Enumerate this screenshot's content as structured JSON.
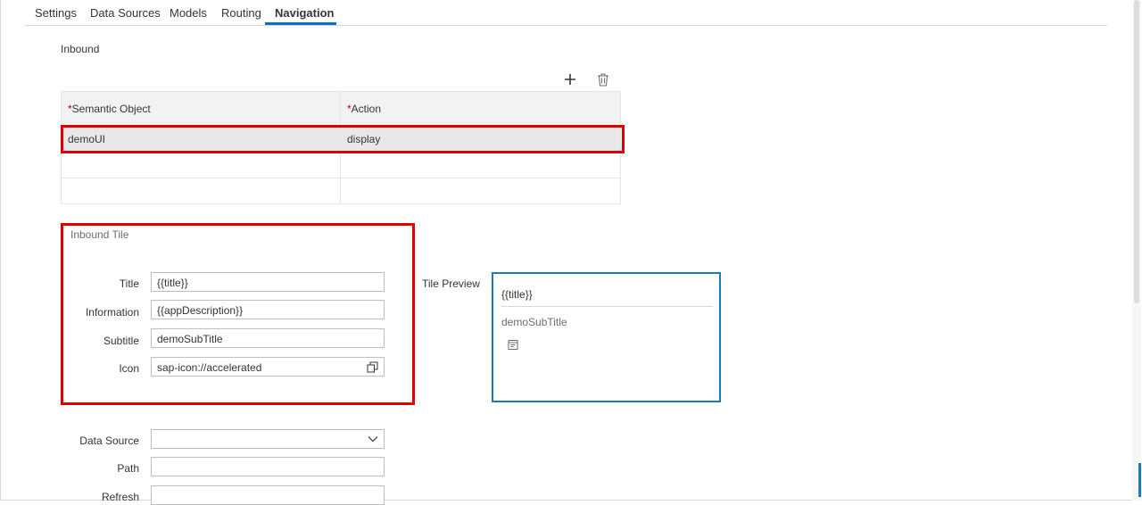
{
  "tabs": [
    "Settings",
    "Data Sources",
    "Models",
    "Routing",
    "Navigation"
  ],
  "inbound": {
    "label": "Inbound",
    "columns": [
      "Semantic Object",
      "Action"
    ],
    "required_mark": "*",
    "rows": [
      {
        "semantic_object": "demoUI",
        "action": "display"
      },
      {
        "semantic_object": "",
        "action": ""
      },
      {
        "semantic_object": "",
        "action": ""
      }
    ]
  },
  "icons": {
    "add": "plus-icon",
    "delete": "trash-icon",
    "copy": "copy-icon",
    "dropdown": "chevron-down-icon",
    "tile": "accelerated-icon"
  },
  "inbound_tile": {
    "label": "Inbound Tile",
    "title_label": "Title",
    "title_value": "{{title}}",
    "information_label": "Information",
    "information_value": "{{appDescription}}",
    "subtitle_label": "Subtitle",
    "subtitle_value": "demoSubTitle",
    "icon_label": "Icon",
    "icon_value": "sap-icon://accelerated"
  },
  "tile_preview": {
    "label": "Tile Preview",
    "title": "{{title}}",
    "subtitle": "demoSubTitle"
  },
  "datasource": {
    "label": "Data Source",
    "value": "",
    "path_label": "Path",
    "path_value": "",
    "refresh_label": "Refresh",
    "refresh_value": ""
  },
  "colors": {
    "accent": "#0a6ed1",
    "highlight": "#e00000",
    "tile_border": "#1a7bb5"
  }
}
